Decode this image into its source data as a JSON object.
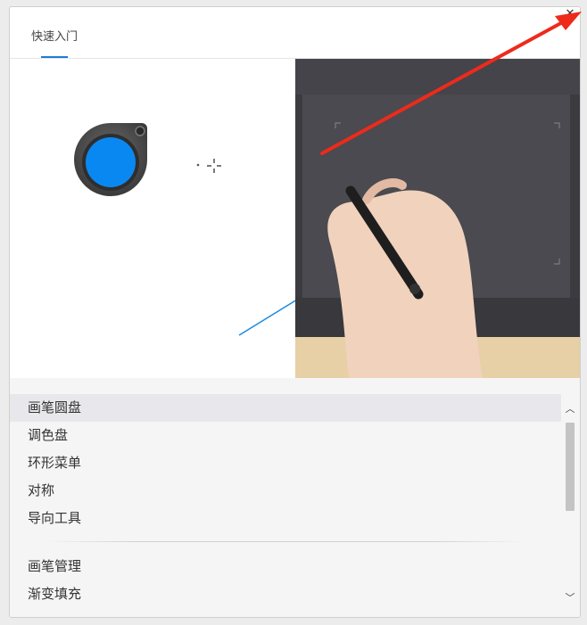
{
  "tabs": [
    {
      "label": "快速入门",
      "active": true
    }
  ],
  "close_icon": "close-icon",
  "colors": {
    "accent": "#1f7bd8",
    "dial_fill": "#0a88f2",
    "annotation_red": "#ee2a1b"
  },
  "list": {
    "group1": [
      {
        "label": "画笔圆盘",
        "selected": true
      },
      {
        "label": "调色盘"
      },
      {
        "label": "环形菜单"
      },
      {
        "label": "对称"
      },
      {
        "label": "导向工具"
      }
    ],
    "group2": [
      {
        "label": "画笔管理"
      },
      {
        "label": "渐变填充"
      }
    ]
  },
  "scroll": {
    "position": 0.0,
    "visible_fraction": 0.55
  }
}
